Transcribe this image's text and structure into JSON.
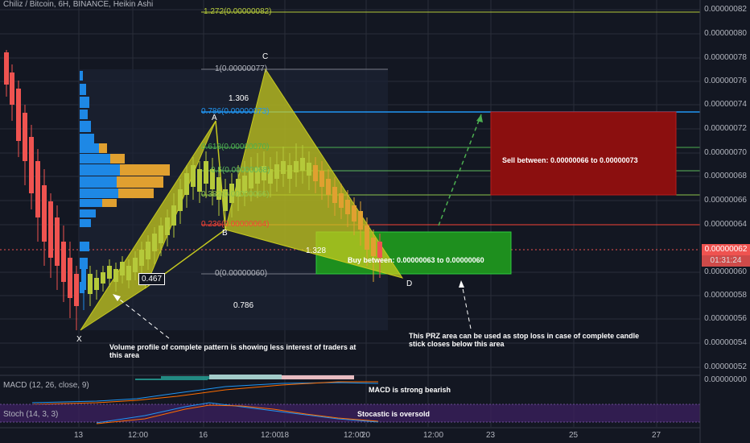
{
  "header": {
    "title": "Chiliz / Bitcoin, 6H, BINANCE, Heikin Ashi"
  },
  "price_axis": {
    "labels": [
      "0.00000082",
      "0.00000080",
      "0.00000078",
      "0.00000076",
      "0.00000074",
      "0.00000072",
      "0.00000070",
      "0.00000068",
      "0.00000066",
      "0.00000064",
      "0.00000060",
      "0.00000058",
      "0.00000056",
      "0.00000054",
      "0.00000052"
    ],
    "current_price": "0.00000062",
    "countdown": "01:31:24",
    "macd_zero": "0.00000000"
  },
  "time_axis": {
    "labels": [
      "13",
      "12:00",
      "16",
      "12:00",
      "18",
      "12:00",
      "20",
      "12:00",
      "23",
      "25",
      "27"
    ]
  },
  "fib_labels": {
    "ext_1272": "1.272(0.00000082)",
    "level_1": "1(0.00000077)",
    "level_0786": "0.786(0.00000073)",
    "level_0618": "0.618(0.00000070)",
    "level_05": "0.5(0.00000068)",
    "level_0382": "0.382(0.00000066)",
    "level_0236": "0.236(0.00000064)",
    "level_0": "0(0.00000060)"
  },
  "pattern": {
    "points": {
      "x": "X",
      "a": "A",
      "b": "B",
      "c": "C",
      "d": "D"
    },
    "ratios": {
      "ab": "0.467",
      "bc": "1.306",
      "cd": "1.328",
      "xd": "0.786"
    }
  },
  "zones": {
    "sell": "Sell between: 0.00000066 to 0.00000073",
    "buy": "Buy between: 0.00000063 to 0.00000060"
  },
  "notes": {
    "volume": "Volume profile of complete pattern is showing less interest of traders at this area",
    "prz": "This PRZ area can be used as stop loss in case of complete candle stick closes below this area",
    "macd": "MACD is strong bearish",
    "stoch": "Stocastic is oversold"
  },
  "indicators": {
    "macd": "MACD (12, 26, close, 9)",
    "stoch": "Stoch (14, 3, 3)"
  },
  "colors": {
    "bull": "#26a69a",
    "bear": "#ef5350",
    "pattern": "#c6c91f",
    "sell_zone": "#8b0f0f",
    "buy_zone": "#1e8f1e",
    "stoch_bg": "#3a1f5c"
  }
}
